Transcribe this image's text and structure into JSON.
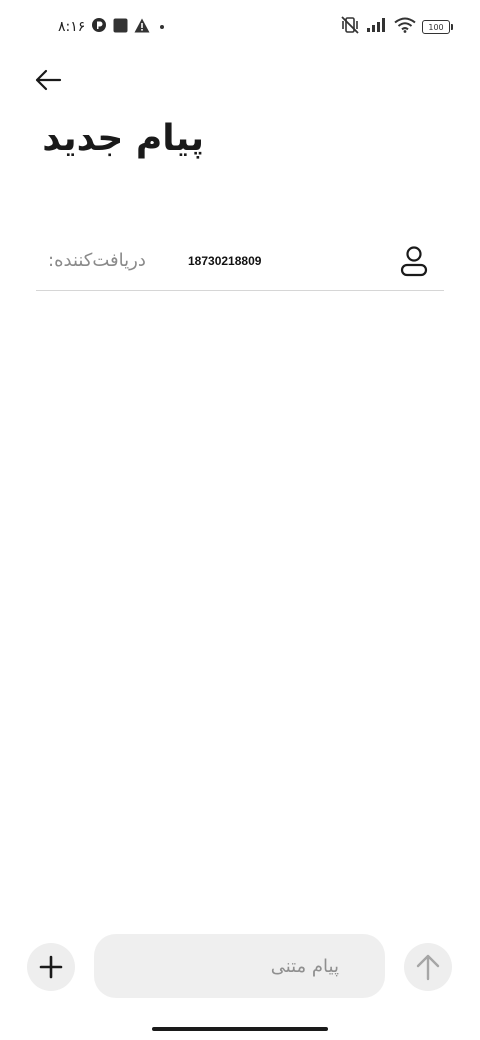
{
  "status_bar": {
    "time": "۸:۱۶",
    "notification_icons": [
      "app-icon",
      "square-icon",
      "warning-icon",
      "dot-icon"
    ],
    "system_icons": [
      "vibrate-off-icon",
      "signal-icon",
      "wifi-icon",
      "battery-icon"
    ],
    "battery_level": "100"
  },
  "header": {
    "back_icon": "arrow-left-icon",
    "title": "پیام جدید"
  },
  "recipient": {
    "label": "دریافت‌کننده:",
    "number": "18730218809",
    "icon": "person-icon"
  },
  "compose": {
    "add_icon": "plus-icon",
    "placeholder": "پیام متنی",
    "value": "",
    "send_icon": "arrow-up-icon"
  },
  "colors": {
    "background": "#ffffff",
    "button_bg": "#eeeeee",
    "divider": "#d6d6d6",
    "muted_text": "#8a8a8a",
    "disabled_icon": "#a6a6a6"
  }
}
